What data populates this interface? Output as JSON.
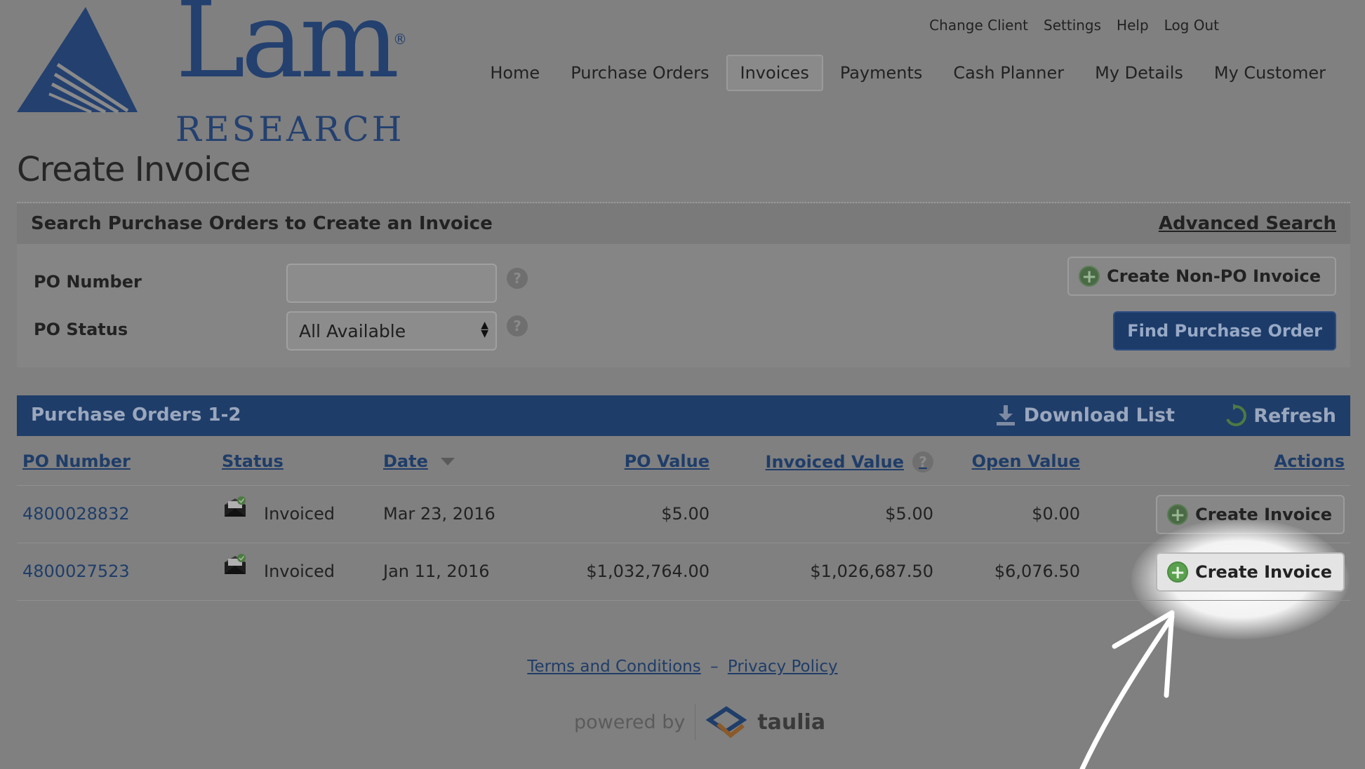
{
  "brand": {
    "logo_word": "Lam",
    "logo_sub": "RESEARCH",
    "logo_mark": "®",
    "brand_color": "#23406f"
  },
  "utility_nav": [
    "Change Client",
    "Settings",
    "Help",
    "Log Out"
  ],
  "main_nav": {
    "items": [
      "Home",
      "Purchase Orders",
      "Invoices",
      "Payments",
      "Cash Planner",
      "My Details",
      "My Customer"
    ],
    "active": "Invoices"
  },
  "page": {
    "title": "Create Invoice"
  },
  "search": {
    "title": "Search Purchase Orders to Create an Invoice",
    "advanced_link": "Advanced Search",
    "po_number_label": "PO Number",
    "po_number_value": "",
    "po_status_label": "PO Status",
    "po_status_value": "All Available",
    "create_nonpo_label": "Create Non-PO Invoice",
    "find_po_label": "Find Purchase Order",
    "help_icon": "question-icon"
  },
  "results": {
    "title": "Purchase Orders 1-2",
    "download_label": "Download List",
    "refresh_label": "Refresh",
    "columns": {
      "po_number": "PO Number",
      "status": "Status",
      "date": "Date",
      "po_value": "PO Value",
      "invoiced_value": "Invoiced Value",
      "open_value": "Open Value",
      "actions": "Actions"
    },
    "sort_column": "Date",
    "sort_direction": "descending",
    "action_label": "Create Invoice",
    "rows": [
      {
        "po_number": "4800028832",
        "status": "Invoiced",
        "date": "Mar 23, 2016",
        "po_value": "$5.00",
        "invoiced_value": "$5.00",
        "open_value": "$0.00"
      },
      {
        "po_number": "4800027523",
        "status": "Invoiced",
        "date": "Jan 11, 2016",
        "po_value": "$1,032,764.00",
        "invoiced_value": "$1,026,687.50",
        "open_value": "$6,076.50"
      }
    ]
  },
  "footer": {
    "terms": "Terms and Conditions",
    "separator": "–",
    "privacy": "Privacy Policy",
    "powered_by": "powered by",
    "taulia": "taulia"
  },
  "colors": {
    "accent": "#1f3d69",
    "overlay": "#808080",
    "add_icon": "#4a6a45"
  }
}
